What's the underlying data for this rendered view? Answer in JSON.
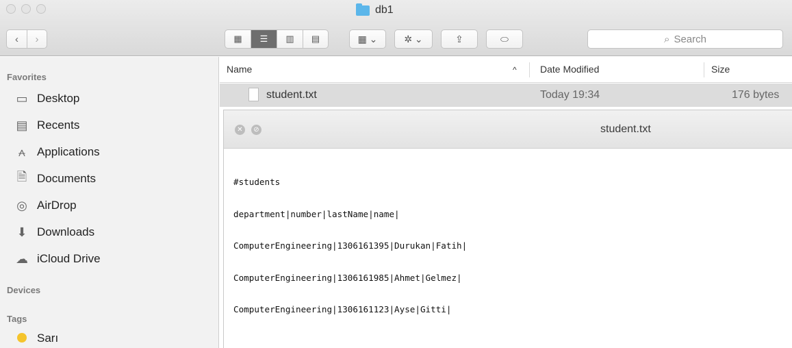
{
  "window": {
    "title": "db1"
  },
  "toolbar": {
    "back_label": "‹",
    "forward_label": "›",
    "view_icons_label": "▦",
    "view_list_label": "☰",
    "view_columns_label": "▥",
    "view_cover_label": "▤",
    "arrange_label": "▦ ⌄",
    "action_label": "✲ ⌄",
    "share_label": "⇪",
    "tag_label": "⬭",
    "search_placeholder": "Search"
  },
  "sidebar": {
    "favorites_header": "Favorites",
    "favorites": [
      {
        "label": "Desktop",
        "icon": "desktop-icon"
      },
      {
        "label": "Recents",
        "icon": "recents-icon"
      },
      {
        "label": "Applications",
        "icon": "applications-icon"
      },
      {
        "label": "Documents",
        "icon": "documents-icon"
      },
      {
        "label": "AirDrop",
        "icon": "airdrop-icon"
      },
      {
        "label": "Downloads",
        "icon": "downloads-icon"
      },
      {
        "label": "iCloud Drive",
        "icon": "cloud-icon"
      }
    ],
    "devices_header": "Devices",
    "tags_header": "Tags",
    "tags": [
      {
        "label": "Sarı",
        "color": "#f5c42c"
      }
    ]
  },
  "file_list": {
    "columns": {
      "name": "Name",
      "date": "Date Modified",
      "size": "Size"
    },
    "sort_indicator": "^",
    "rows": [
      {
        "name": "student.txt",
        "date": "Today 19:34",
        "size": "176 bytes"
      }
    ]
  },
  "quicklook": {
    "title": "student.txt",
    "lines": [
      "#students",
      "department|number|lastName|name|",
      "ComputerEngineering|1306161395|Durukan|Fatih|",
      "ComputerEngineering|1306161985|Ahmet|Gelmez|",
      "ComputerEngineering|1306161123|Ayse|Gitti|"
    ]
  }
}
